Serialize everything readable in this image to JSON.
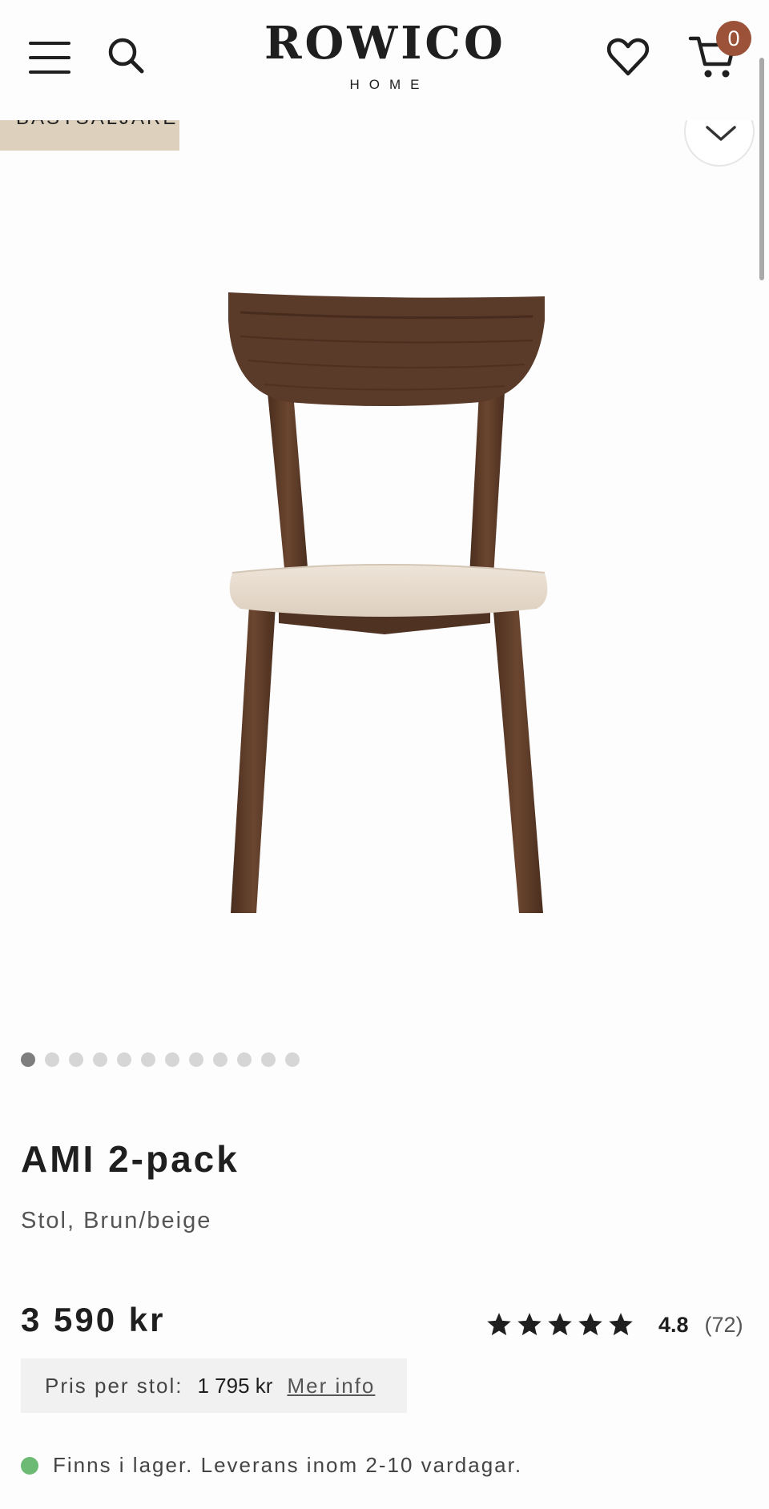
{
  "header": {
    "logo_main": "ROWICO",
    "logo_sub": "HOME",
    "cart_count": "0",
    "icons": [
      "menu-icon",
      "search-icon",
      "heart-icon",
      "cart-icon"
    ]
  },
  "gallery": {
    "badge": "BÄSTSÄLJARE",
    "image_count": 12,
    "active_index": 0
  },
  "product": {
    "title": "AMI 2-pack",
    "subtitle": "Stol, Brun/beige",
    "price": "3 590 kr",
    "rating_value": "4.8",
    "rating_count": "(72)",
    "stars_filled": 5,
    "unit_price_label": "Pris per stol:",
    "unit_price_value": "1 795 kr",
    "unit_price_link": "Mer info",
    "stock_text": "Finns i lager. Leverans inom 2-10 vardagar."
  },
  "colors": {
    "badge_bg": "#ddd1bd",
    "cart_badge": "#9c5139",
    "stock_dot": "#6cba73",
    "wood": "#5a3a28",
    "seat": "#e7dccf"
  }
}
